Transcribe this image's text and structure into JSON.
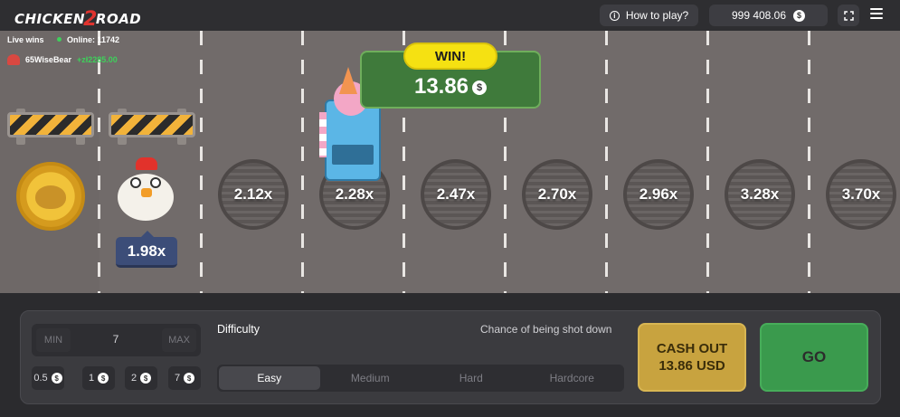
{
  "header": {
    "logo": {
      "part1": "CHICKEN",
      "part2": "2",
      "part3": "ROAD"
    },
    "how_to_play": "How to play?",
    "balance": "999 408.06",
    "currency_symbol": "$"
  },
  "live": {
    "title": "Live wins",
    "online": "Online: 11742",
    "last_winner": {
      "name": "65WiseBear",
      "amount": "+zł2285.00"
    }
  },
  "game": {
    "current_multiplier": "1.98x",
    "lane_multipliers": [
      "2.12x",
      "2.28x",
      "2.47x",
      "2.70x",
      "2.96x",
      "3.28x",
      "3.70x"
    ],
    "win_label": "WIN!",
    "win_amount": "13.86"
  },
  "controls": {
    "min_label": "MIN",
    "max_label": "MAX",
    "bet_value": "7",
    "quick_bets": [
      "0.5",
      "1",
      "2",
      "7"
    ],
    "difficulty_label": "Difficulty",
    "chance_label": "Chance of being shot down",
    "difficulties": [
      "Easy",
      "Medium",
      "Hard",
      "Hardcore"
    ],
    "active_difficulty": "Easy",
    "cashout_line1": "CASH OUT",
    "cashout_line2": "13.86 USD",
    "go_label": "GO"
  },
  "colors": {
    "road": "#716b6a",
    "win_tag": "#f5e112",
    "win_box": "#3f7a3b",
    "cashout": "#c8a33f",
    "go": "#3a9a4d"
  }
}
